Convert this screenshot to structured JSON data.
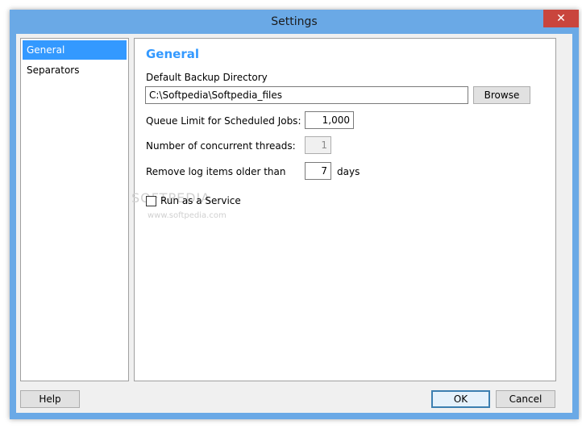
{
  "window": {
    "title": "Settings",
    "close_glyph": "✕"
  },
  "sidebar": {
    "items": [
      {
        "label": "General",
        "selected": true
      },
      {
        "label": "Separators",
        "selected": false
      }
    ]
  },
  "general": {
    "heading": "General",
    "backup_dir_label": "Default Backup Directory",
    "backup_dir_value": "C:\\Softpedia\\Softpedia_files",
    "browse_label": "Browse",
    "queue_limit_label": "Queue Limit for Scheduled Jobs:",
    "queue_limit_value": "1,000",
    "threads_label": "Number of concurrent threads:",
    "threads_value": "1",
    "log_label": "Remove log items older than",
    "log_value": "7",
    "log_unit": "days",
    "run_service_label": "Run as a Service",
    "run_service_checked": false
  },
  "footer": {
    "help_label": "Help",
    "ok_label": "OK",
    "cancel_label": "Cancel"
  },
  "watermark": {
    "logo_text": "SOFTPEDIA",
    "url_text": "www.softpedia.com"
  },
  "colors": {
    "frame": "#6aa9e6",
    "accent": "#3399ff",
    "close": "#c9453d"
  }
}
